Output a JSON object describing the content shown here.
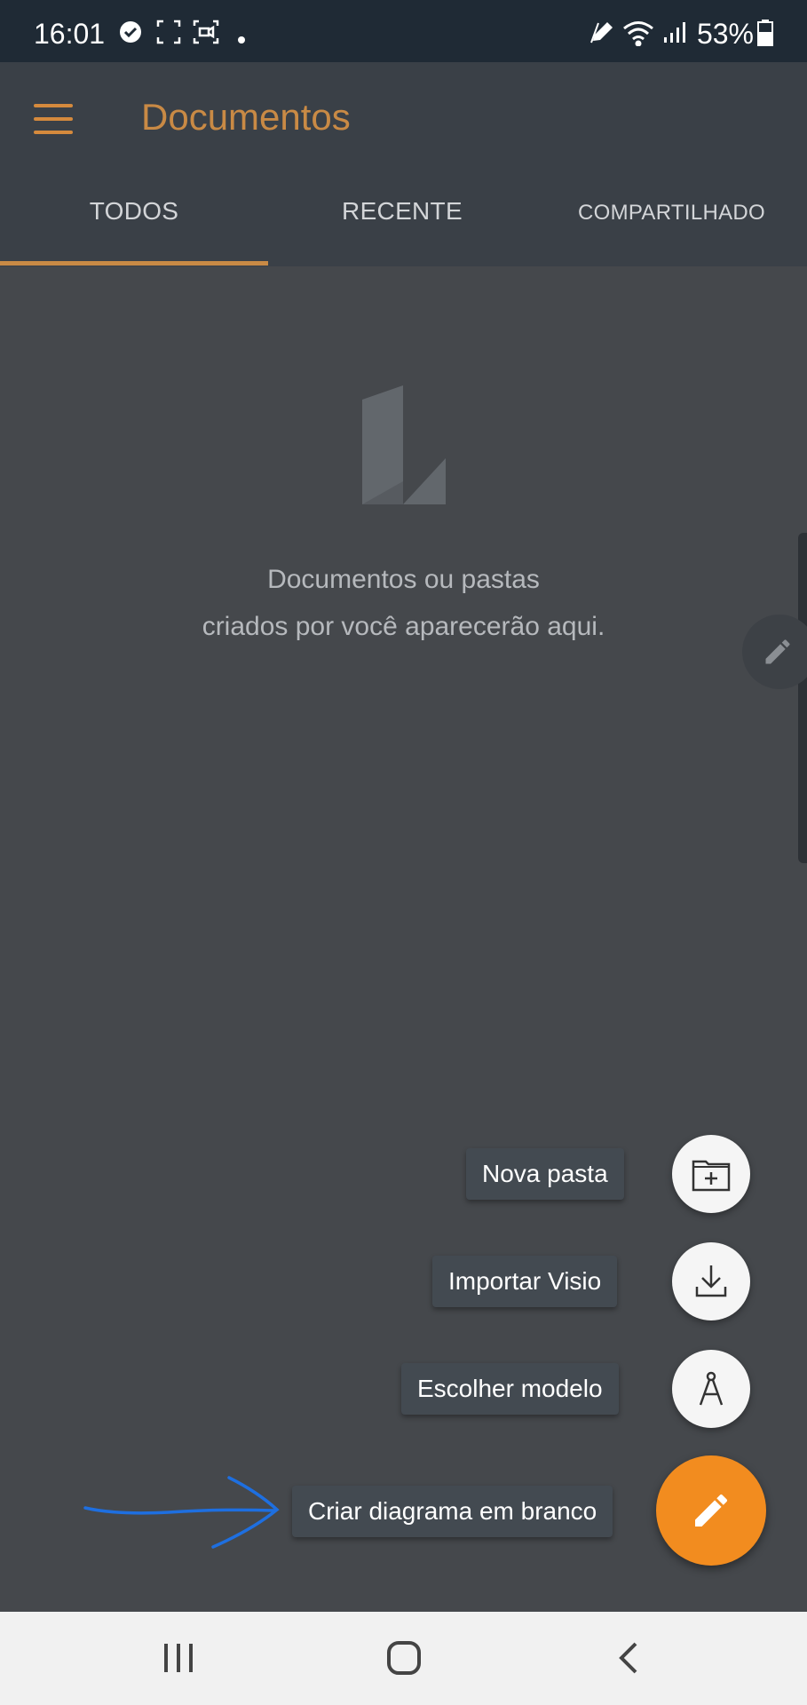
{
  "status_bar": {
    "time": "16:01",
    "battery": "53%"
  },
  "app_bar": {
    "title": "Documentos"
  },
  "tabs": [
    {
      "label": "TODOS",
      "selected": true
    },
    {
      "label": "RECENTE",
      "selected": false
    },
    {
      "label": "COMPARTILHADO",
      "selected": false
    }
  ],
  "empty_state": {
    "line1": "Documentos ou pastas",
    "line2": "criados por você aparecerão aqui."
  },
  "fab_menu": {
    "items": [
      {
        "label": "Nova pasta",
        "icon": "folder-plus-icon"
      },
      {
        "label": "Importar Visio",
        "icon": "download-icon"
      },
      {
        "label": "Escolher modelo",
        "icon": "compass-icon"
      },
      {
        "label": "Criar diagrama em branco",
        "icon": "pencil-icon"
      }
    ]
  },
  "colors": {
    "accent": "#c98a45",
    "fab": "#f28c1f",
    "background": "#45484c",
    "app_bar": "#3a4047",
    "annotation_arrow": "#1e6fe0"
  }
}
